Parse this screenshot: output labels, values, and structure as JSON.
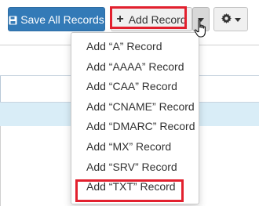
{
  "toolbar": {
    "save_label": "Save All Records",
    "add_label": "Add Record",
    "save_icon": "floppy-disk-icon",
    "add_icon": "plus-icon",
    "gear_icon": "gear-icon"
  },
  "menu": {
    "items": [
      "Add “A” Record",
      "Add “AAAA” Record",
      "Add “CAA” Record",
      "Add “CNAME” Record",
      "Add “DMARC” Record",
      "Add “MX” Record",
      "Add “SRV” Record",
      "Add “TXT” Record"
    ]
  },
  "colors": {
    "primary": "#337ab7",
    "highlight": "#e2202e",
    "row_info": "#d9edf7"
  }
}
